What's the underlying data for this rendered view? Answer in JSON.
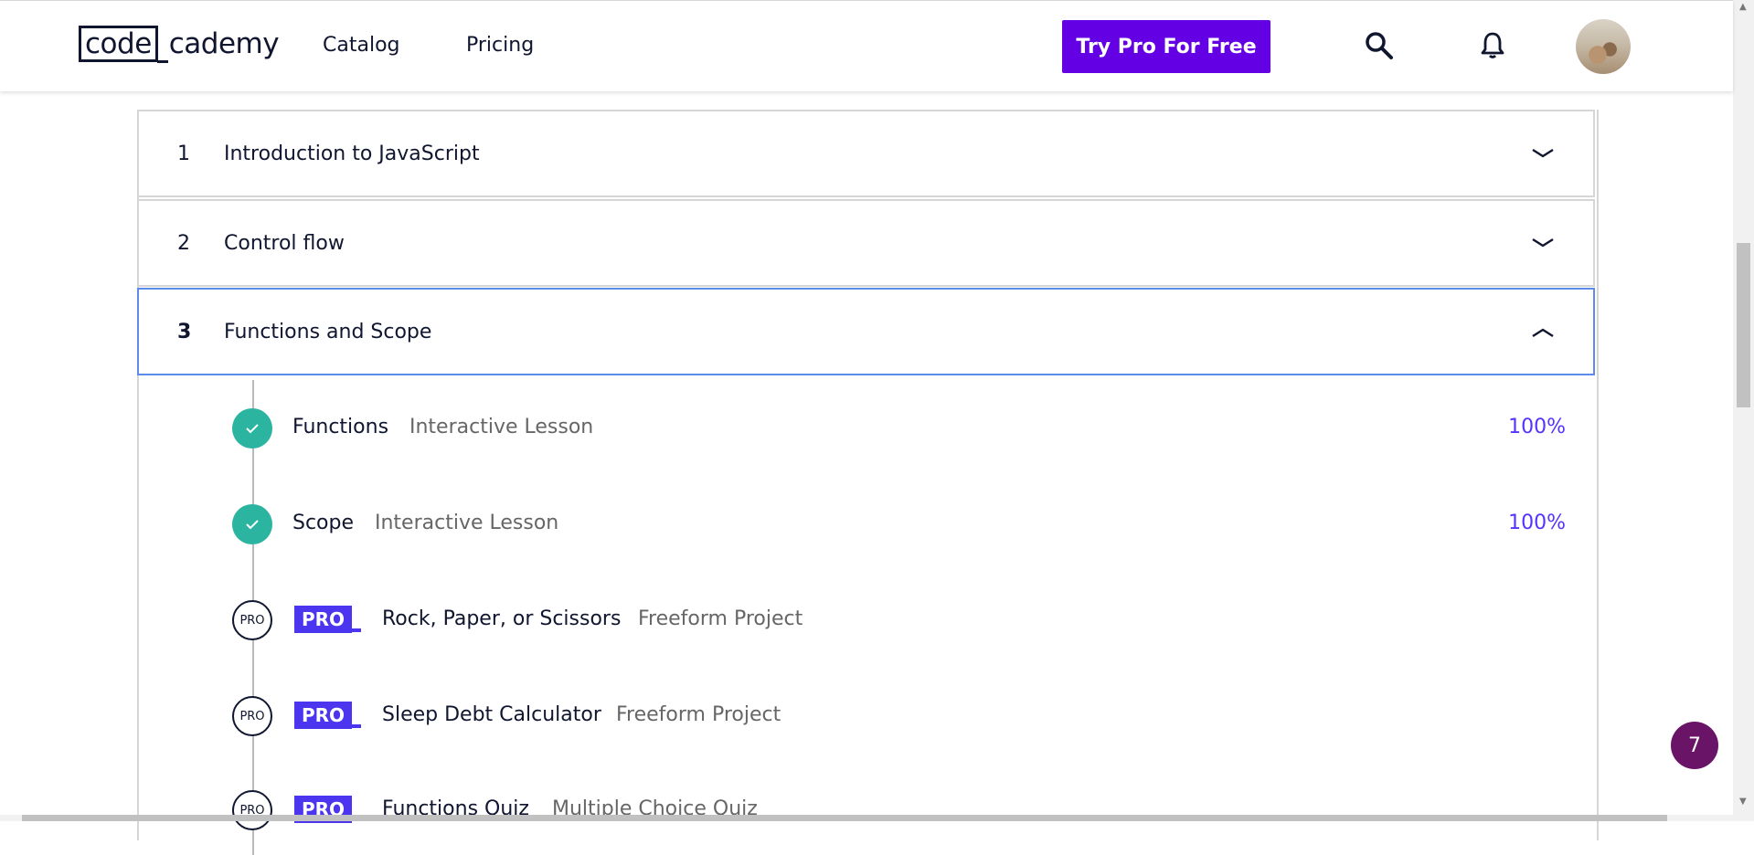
{
  "header": {
    "logo_part1": "code",
    "logo_part2": "cademy",
    "nav": [
      "Catalog",
      "Pricing"
    ],
    "cta_label": "Try Pro For Free",
    "accent_color": "#6400e4"
  },
  "modules": [
    {
      "number": "1",
      "title": "Introduction to JavaScript",
      "expanded": false
    },
    {
      "number": "2",
      "title": "Control flow",
      "expanded": false
    },
    {
      "number": "3",
      "title": "Functions and Scope",
      "expanded": true
    }
  ],
  "lessons": [
    {
      "title": "Functions",
      "type": "Interactive Lesson",
      "progress": "100%",
      "status": "complete"
    },
    {
      "title": "Scope",
      "type": "Interactive Lesson",
      "progress": "100%",
      "status": "complete"
    },
    {
      "title": "Rock, Paper, or Scissors",
      "type": "Freeform Project",
      "status": "pro",
      "badge": "PRO",
      "circle_label": "PRO"
    },
    {
      "title": "Sleep Debt Calculator",
      "type": "Freeform Project",
      "status": "pro",
      "badge": "PRO",
      "circle_label": "PRO"
    },
    {
      "title": "Functions Quiz",
      "type": "Multiple Choice Quiz",
      "status": "pro",
      "badge": "PRO",
      "circle_label": "PRO"
    }
  ],
  "chat_badge_count": "7",
  "colors": {
    "complete": "#2bb4a0",
    "pro_badge": "#4b35ef",
    "progress_text": "#5533ff",
    "active_border": "#5d8be8"
  }
}
